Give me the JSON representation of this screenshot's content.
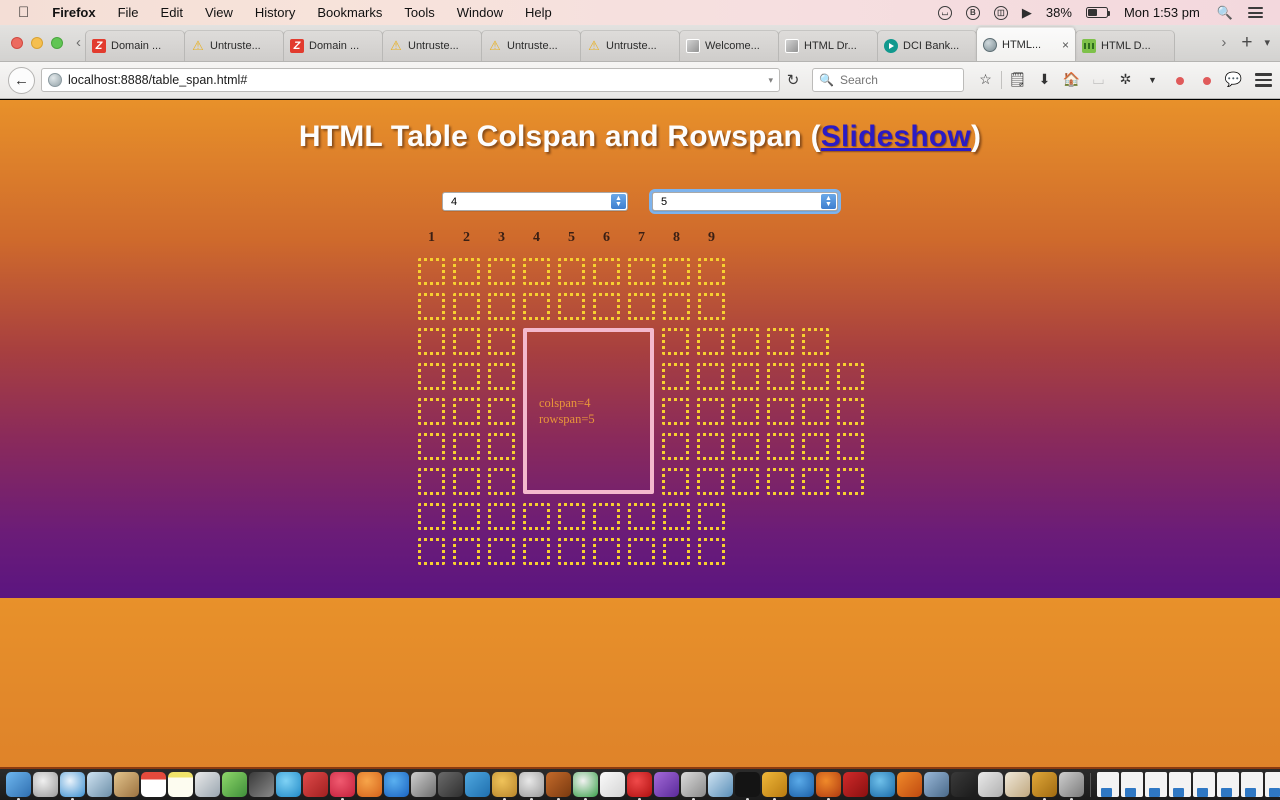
{
  "menubar": {
    "apple": "apple-logo",
    "items": [
      "Firefox",
      "File",
      "Edit",
      "View",
      "History",
      "Bookmarks",
      "Tools",
      "Window",
      "Help"
    ],
    "status": {
      "battery_percent": "38%",
      "clock": "Mon 1:53 pm",
      "icons": [
        "sync-icon",
        "bitcoin-icon",
        "airplay-icon",
        "wifi-icon",
        "battery-icon",
        "search-icon",
        "notification-center-icon"
      ]
    }
  },
  "browser": {
    "window_controls": [
      "close-button",
      "minimize-button",
      "zoom-button"
    ],
    "tabs": [
      {
        "label": "Domain ...",
        "favicon": "gray-page-icon",
        "active": false
      },
      {
        "label": "Untruste...",
        "favicon": "warning-icon",
        "active": false
      },
      {
        "label": "Domain ...",
        "favicon": "zone-z-icon",
        "active": false
      },
      {
        "label": "Untruste...",
        "favicon": "warning-icon",
        "active": false
      },
      {
        "label": "Untruste...",
        "favicon": "warning-icon",
        "active": false
      },
      {
        "label": "Untruste...",
        "favicon": "warning-icon",
        "active": false
      },
      {
        "label": "Welcome...",
        "favicon": "gray-page-icon",
        "active": false
      },
      {
        "label": "HTML Dr...",
        "favicon": "gray-page-icon",
        "active": false
      },
      {
        "label": "DCI Bank...",
        "favicon": "teal-play-icon",
        "active": false
      },
      {
        "label": "HTML...",
        "favicon": "globe-icon",
        "active": true,
        "close": "×"
      },
      {
        "label": "HTML D...",
        "favicon": "green-grid-icon",
        "active": false
      }
    ],
    "tab_scroll_left": "‹",
    "tab_scroll_right": "›",
    "new_tab": "+",
    "tab_list_menu": "▾",
    "back_button": "←",
    "url": "localhost:8888/table_span.html#",
    "url_dropdown": "▾",
    "reload": "↻",
    "search_placeholder": "Search",
    "toolbar_icons": [
      "bookmark-star-icon",
      "library-icon",
      "downloads-icon",
      "home-icon",
      "sync-circle-icon",
      "pocket-icon",
      "overflow-chevron-icon",
      "addon-dot-red-icon",
      "addon-dot-red2-icon",
      "chat-icon",
      "menu-hamburger-icon"
    ]
  },
  "page": {
    "title_main": "HTML Table Colspan and Rowspan (",
    "title_link": "Slideshow",
    "title_close": ")",
    "selects": [
      {
        "name": "colspan-select",
        "value": "4",
        "focused": false
      },
      {
        "name": "rowspan-select",
        "value": "5",
        "focused": true
      }
    ],
    "column_headers": [
      "1",
      "2",
      "3",
      "4",
      "5",
      "6",
      "7",
      "8",
      "9"
    ],
    "span_cell": {
      "colspan_text": "colspan=4",
      "rowspan_text": "rowspan=5",
      "border_color": "#f4b9cd",
      "text_color": "#e8953a"
    },
    "cell_border_color": "#f7d030",
    "rows": [
      {
        "cells_before": 9,
        "span": false,
        "cells_after": 0
      },
      {
        "cells_before": 9,
        "span": false,
        "cells_after": 0
      },
      {
        "cells_before": 3,
        "span": true,
        "cells_after": 5
      },
      {
        "cells_before": 3,
        "span": false,
        "cells_after": 6
      },
      {
        "cells_before": 3,
        "span": false,
        "cells_after": 6
      },
      {
        "cells_before": 3,
        "span": false,
        "cells_after": 6
      },
      {
        "cells_before": 3,
        "span": false,
        "cells_after": 6
      },
      {
        "cells_before": 9,
        "span": false,
        "cells_after": 0
      },
      {
        "cells_before": 9,
        "span": false,
        "cells_after": 0
      }
    ],
    "background": {
      "top": "#e8912a",
      "bottom": "#5b1580",
      "under": "#e2882a"
    }
  },
  "dock": {
    "apps": [
      {
        "name": "finder",
        "color": "linear-gradient(135deg,#6fb7ef,#2f6fb0)",
        "running": true
      },
      {
        "name": "launchpad",
        "color": "radial-gradient(circle at 40% 35%,#f0f0f0,#9a9a9a)",
        "running": false
      },
      {
        "name": "safari",
        "color": "radial-gradient(circle at 40% 35%,#eaf3fb,#3a8fd0)",
        "running": true
      },
      {
        "name": "preview",
        "color": "linear-gradient(135deg,#cfe3f2,#6d8fa8)",
        "running": false
      },
      {
        "name": "contacts",
        "color": "linear-gradient(135deg,#e3c48c,#9c7240)",
        "running": false
      },
      {
        "name": "calendar",
        "color": "linear-gradient(180deg,#e34a3c 0 30%,#ffffff 30% 100%)",
        "running": false
      },
      {
        "name": "notes",
        "color": "linear-gradient(180deg,#f0e36a 0 22%,#fdfcf0 22% 100%)",
        "running": false
      },
      {
        "name": "reminders",
        "color": "linear-gradient(135deg,#eaeaea,#9aa6b0)",
        "running": false
      },
      {
        "name": "maps",
        "color": "linear-gradient(135deg,#8fd86a,#3f8f3a)",
        "running": false
      },
      {
        "name": "photos",
        "color": "linear-gradient(135deg,#3a3a3a,#8a8a8a)",
        "running": false
      },
      {
        "name": "messages",
        "color": "radial-gradient(circle at 40% 35%,#7fd2f5,#2089c6)",
        "running": false
      },
      {
        "name": "facetime",
        "color": "linear-gradient(135deg,#e04a4a,#a12020)",
        "running": false
      },
      {
        "name": "itunes",
        "color": "radial-gradient(circle at 40% 35%,#f05a70,#c31f3b)",
        "running": true
      },
      {
        "name": "ibooks",
        "color": "radial-gradient(circle at 40% 35%,#f7a54a,#d4621a)",
        "running": false
      },
      {
        "name": "app-store",
        "color": "radial-gradient(circle at 40% 35%,#5ab0f0,#1a63c0)",
        "running": false
      },
      {
        "name": "system-preferences",
        "color": "linear-gradient(135deg,#cfcfcf,#6e6e6e)",
        "running": false
      },
      {
        "name": "utility",
        "color": "linear-gradient(135deg,#6b6b6b,#2f2f2f)",
        "running": false
      },
      {
        "name": "trash-bucket",
        "color": "linear-gradient(135deg,#4fa8e0,#1f6fae)",
        "running": false
      },
      {
        "name": "wordpress",
        "color": "radial-gradient(circle at 40% 35%,#f0c35a,#b8852a)",
        "running": true
      },
      {
        "name": "ghost",
        "color": "radial-gradient(circle at 40% 35%,#e8e8e8,#9a9a9a)",
        "running": true
      },
      {
        "name": "gimp",
        "color": "linear-gradient(135deg,#c46a2a,#7a3a10)",
        "running": true
      },
      {
        "name": "chrome",
        "color": "radial-gradient(circle at 40% 35%,#f2f2f2,#3aa14a)",
        "running": true
      },
      {
        "name": "text-editor",
        "color": "linear-gradient(135deg,#fafafa,#d4d4d4)",
        "running": false
      },
      {
        "name": "opera",
        "color": "radial-gradient(circle at 40% 35%,#f04a4a,#b00f0f)",
        "running": true
      },
      {
        "name": "star-app",
        "color": "linear-gradient(135deg,#a46ad8,#5a2a9a)",
        "running": false
      },
      {
        "name": "image-viewer",
        "color": "linear-gradient(135deg,#dcdcdc,#8a8a8a)",
        "running": true
      },
      {
        "name": "mail",
        "color": "linear-gradient(135deg,#cfe3f2,#5a8fb8)",
        "running": false
      },
      {
        "name": "terminal",
        "color": "#141414",
        "running": true
      },
      {
        "name": "inkscape",
        "color": "linear-gradient(135deg,#f0b83a,#b87a10)",
        "running": true
      },
      {
        "name": "bitcoin",
        "color": "radial-gradient(circle at 40% 35%,#5aaae8,#1a5fa8)",
        "running": false
      },
      {
        "name": "firefox",
        "color": "radial-gradient(circle at 40% 35%,#f08a2a,#b03a10)",
        "running": true
      },
      {
        "name": "filezilla",
        "color": "linear-gradient(135deg,#d02a2a,#8a1010)",
        "running": false
      },
      {
        "name": "browser-blue",
        "color": "radial-gradient(circle at 40% 35%,#6fc0ea,#1a6aa8)",
        "running": false
      },
      {
        "name": "vlc",
        "color": "linear-gradient(135deg,#f08a2a,#c04a10)",
        "running": false
      },
      {
        "name": "remote-desktop",
        "color": "linear-gradient(135deg,#9ab8d8,#4a6a8a)",
        "running": false
      },
      {
        "name": "help-viewer",
        "color": "linear-gradient(135deg,#3a3a3a,#1a1a1a)",
        "running": false
      },
      {
        "name": "package",
        "color": "linear-gradient(135deg,#eaeaea,#b0b0b0)",
        "running": false
      },
      {
        "name": "docs-app",
        "color": "linear-gradient(135deg,#f0e8d8,#c0a880)",
        "running": false
      },
      {
        "name": "paint-app",
        "color": "linear-gradient(135deg,#e0a83a,#a06a10)",
        "running": true
      },
      {
        "name": "screenshot-app",
        "color": "linear-gradient(135deg,#cfcfcf,#7a7a7a)",
        "running": true
      }
    ],
    "documents_count": 16,
    "trash": "trash-icon"
  }
}
